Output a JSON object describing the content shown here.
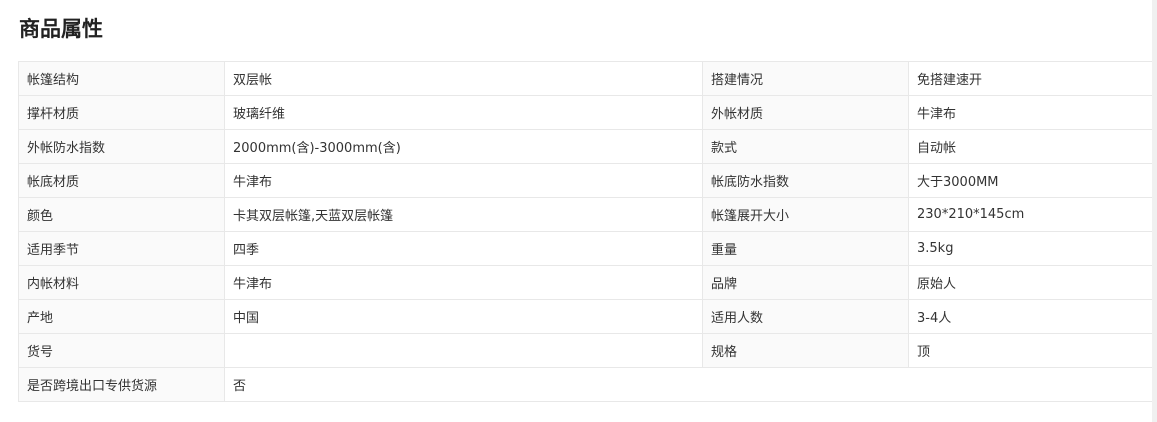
{
  "section": {
    "title": "商品属性"
  },
  "attributes": {
    "rows": [
      {
        "label1": "帐篷结构",
        "value1": "双层帐",
        "label2": "搭建情况",
        "value2": "免搭建速开"
      },
      {
        "label1": "撑杆材质",
        "value1": "玻璃纤维",
        "label2": "外帐材质",
        "value2": "牛津布"
      },
      {
        "label1": "外帐防水指数",
        "value1": "2000mm(含)-3000mm(含)",
        "label2": "款式",
        "value2": "自动帐"
      },
      {
        "label1": "帐底材质",
        "value1": "牛津布",
        "label2": "帐底防水指数",
        "value2": "大于3000MM"
      },
      {
        "label1": "颜色",
        "value1": "卡其双层帐篷,天蓝双层帐篷",
        "label2": "帐篷展开大小",
        "value2": "230*210*145cm"
      },
      {
        "label1": "适用季节",
        "value1": "四季",
        "label2": "重量",
        "value2": "3.5kg"
      },
      {
        "label1": "内帐材料",
        "value1": "牛津布",
        "label2": "品牌",
        "value2": "原始人"
      },
      {
        "label1": "产地",
        "value1": "中国",
        "label2": "适用人数",
        "value2": "3-4人"
      },
      {
        "label1": "货号",
        "value1": "",
        "label2": "规格",
        "value2": "顶"
      },
      {
        "label1": "是否跨境出口专供货源",
        "value1": "否",
        "label2": "",
        "value2": ""
      }
    ]
  }
}
